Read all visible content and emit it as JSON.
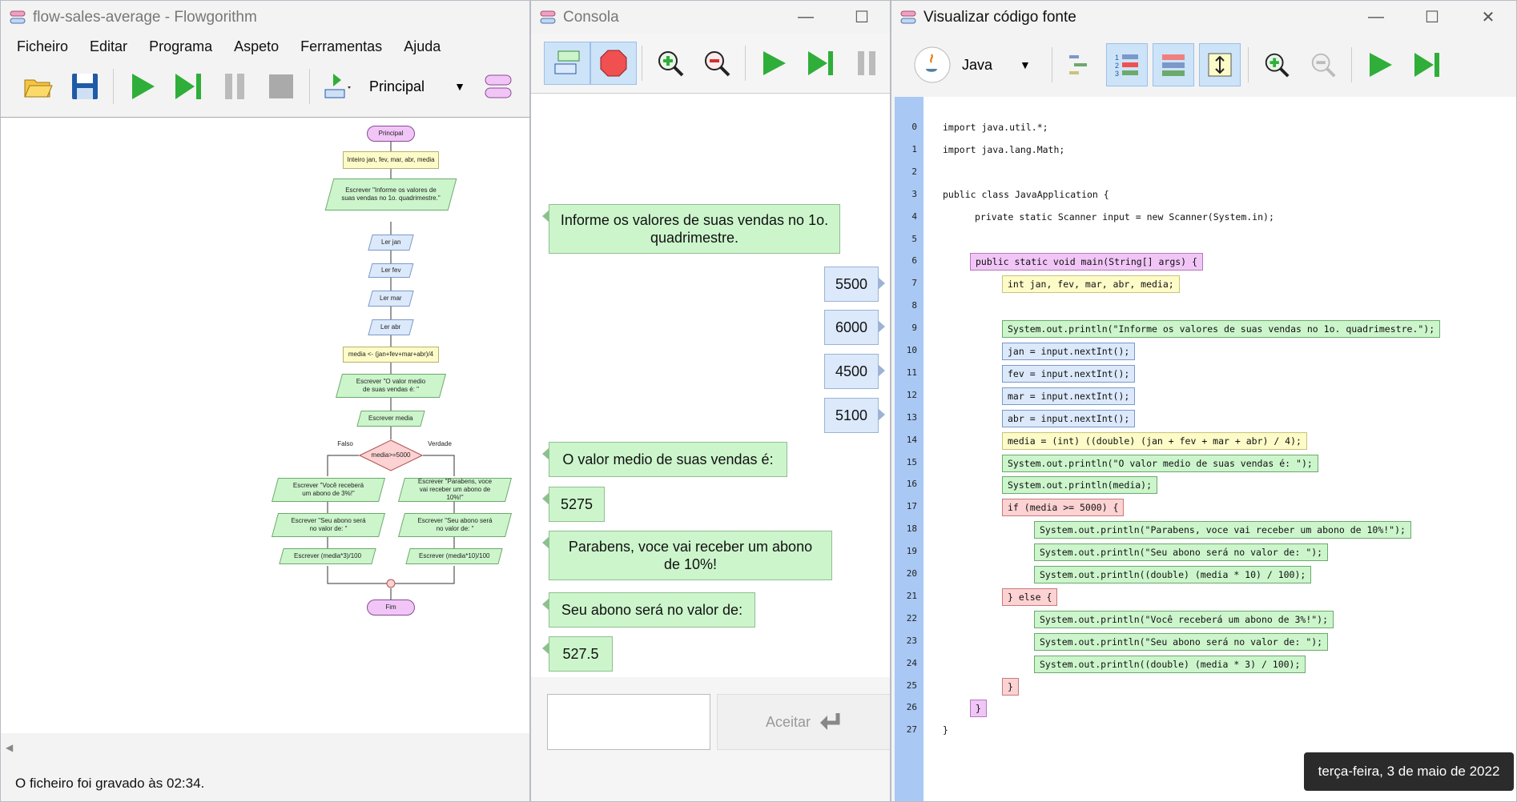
{
  "flowgorithm": {
    "title": "flow-sales-average - Flowgorithm",
    "menu": [
      "Ficheiro",
      "Editar",
      "Programa",
      "Aspeto",
      "Ferramentas",
      "Ajuda"
    ],
    "function_selector": "Principal",
    "status": "O ficheiro foi gravado às 02:34.",
    "flowchart": {
      "start": "Principal",
      "declare": "Inteiro jan, fev, mar, abr, media",
      "output1": "Escrever \"Informe os valores de suas vendas no 1o. quadrimestre.\"",
      "inputs": [
        "Ler jan",
        "Ler fev",
        "Ler mar",
        "Ler abr"
      ],
      "assign": "media <- (jan+fev+mar+abr)/4",
      "output2": "Escrever \"O valor medio de suas vendas é: \"",
      "output3": "Escrever media",
      "condition": "media>=5000",
      "false_label": "Falso",
      "true_label": "Verdade",
      "false_branch": [
        "Escrever \"Você receberá um abono de 3%!\"",
        "Escrever \"Seu abono será no valor de: \"",
        "Escrever (media*3)/100"
      ],
      "true_branch": [
        "Escrever \"Parabens, voce vai receber um abono de 10%!\"",
        "Escrever \"Seu abono será no valor de: \"",
        "Escrever (media*10)/100"
      ],
      "end": "Fim"
    }
  },
  "console": {
    "title": "Consola",
    "messages": [
      {
        "kind": "output",
        "text": "Informe os valores de suas vendas no 1o. quadrimestre."
      },
      {
        "kind": "input",
        "text": "5500"
      },
      {
        "kind": "input",
        "text": "6000"
      },
      {
        "kind": "input",
        "text": "4500"
      },
      {
        "kind": "input",
        "text": "5100"
      },
      {
        "kind": "output",
        "text": "O valor medio de suas vendas é:"
      },
      {
        "kind": "output",
        "text": "5275"
      },
      {
        "kind": "output",
        "text": "Parabens, voce vai receber um abono de 10%!"
      },
      {
        "kind": "output",
        "text": "Seu abono será no valor de:"
      },
      {
        "kind": "output",
        "text": "527.5"
      }
    ],
    "input_value": "",
    "accept_label": "Aceitar"
  },
  "code_viewer": {
    "title": "Visualizar código fonte",
    "language": "Java",
    "lines": [
      {
        "n": "0",
        "text": "import java.util.*;",
        "indent": 0,
        "hl": ""
      },
      {
        "n": "1",
        "text": "import java.lang.Math;",
        "indent": 0,
        "hl": ""
      },
      {
        "n": "2",
        "text": "",
        "indent": 0,
        "hl": ""
      },
      {
        "n": "3",
        "text": "public class JavaApplication {",
        "indent": 0,
        "hl": ""
      },
      {
        "n": "4",
        "text": "private static Scanner input = new Scanner(System.in);",
        "indent": 1,
        "hl": ""
      },
      {
        "n": "5",
        "text": "",
        "indent": 0,
        "hl": ""
      },
      {
        "n": "6",
        "text": "public static void main(String[] args) {",
        "indent": 1,
        "hl": "purple"
      },
      {
        "n": "7",
        "text": "int jan, fev, mar, abr, media;",
        "indent": 2,
        "hl": "yellow"
      },
      {
        "n": "8",
        "text": "",
        "indent": 0,
        "hl": ""
      },
      {
        "n": "9",
        "text": "System.out.println(\"Informe os valores de suas vendas no 1o. quadrimestre.\");",
        "indent": 2,
        "hl": "green"
      },
      {
        "n": "10",
        "text": "jan = input.nextInt();",
        "indent": 2,
        "hl": "blue"
      },
      {
        "n": "11",
        "text": "fev = input.nextInt();",
        "indent": 2,
        "hl": "blue"
      },
      {
        "n": "12",
        "text": "mar = input.nextInt();",
        "indent": 2,
        "hl": "blue"
      },
      {
        "n": "13",
        "text": "abr = input.nextInt();",
        "indent": 2,
        "hl": "blue"
      },
      {
        "n": "14",
        "text": "media = (int) ((double) (jan + fev + mar + abr) / 4);",
        "indent": 2,
        "hl": "yellow"
      },
      {
        "n": "15",
        "text": "System.out.println(\"O valor medio de suas vendas é: \");",
        "indent": 2,
        "hl": "green"
      },
      {
        "n": "16",
        "text": "System.out.println(media);",
        "indent": 2,
        "hl": "green"
      },
      {
        "n": "17",
        "text": "if (media >= 5000) {",
        "indent": 2,
        "hl": "red"
      },
      {
        "n": "18",
        "text": "System.out.println(\"Parabens, voce vai receber um abono de 10%!\");",
        "indent": 3,
        "hl": "green"
      },
      {
        "n": "19",
        "text": "System.out.println(\"Seu abono será no valor de: \");",
        "indent": 3,
        "hl": "green"
      },
      {
        "n": "20",
        "text": "System.out.println((double) (media * 10) / 100);",
        "indent": 3,
        "hl": "green"
      },
      {
        "n": "21",
        "text": "} else {",
        "indent": 2,
        "hl": "red"
      },
      {
        "n": "22",
        "text": "System.out.println(\"Você receberá um abono de 3%!\");",
        "indent": 3,
        "hl": "green"
      },
      {
        "n": "23",
        "text": "System.out.println(\"Seu abono será no valor de: \");",
        "indent": 3,
        "hl": "green"
      },
      {
        "n": "24",
        "text": "System.out.println((double) (media * 3) / 100);",
        "indent": 3,
        "hl": "green"
      },
      {
        "n": "25",
        "text": "}",
        "indent": 2,
        "hl": "red"
      },
      {
        "n": "26",
        "text": "}",
        "indent": 1,
        "hl": "purple"
      },
      {
        "n": "27",
        "text": "}",
        "indent": 0,
        "hl": ""
      }
    ]
  },
  "tooltip": "terça-feira, 3 de maio de 2022",
  "icons": {
    "open": "folder-open-icon",
    "save": "save-icon",
    "run": "play-icon",
    "step": "step-icon",
    "pause": "pause-icon",
    "stop": "stop-icon"
  }
}
